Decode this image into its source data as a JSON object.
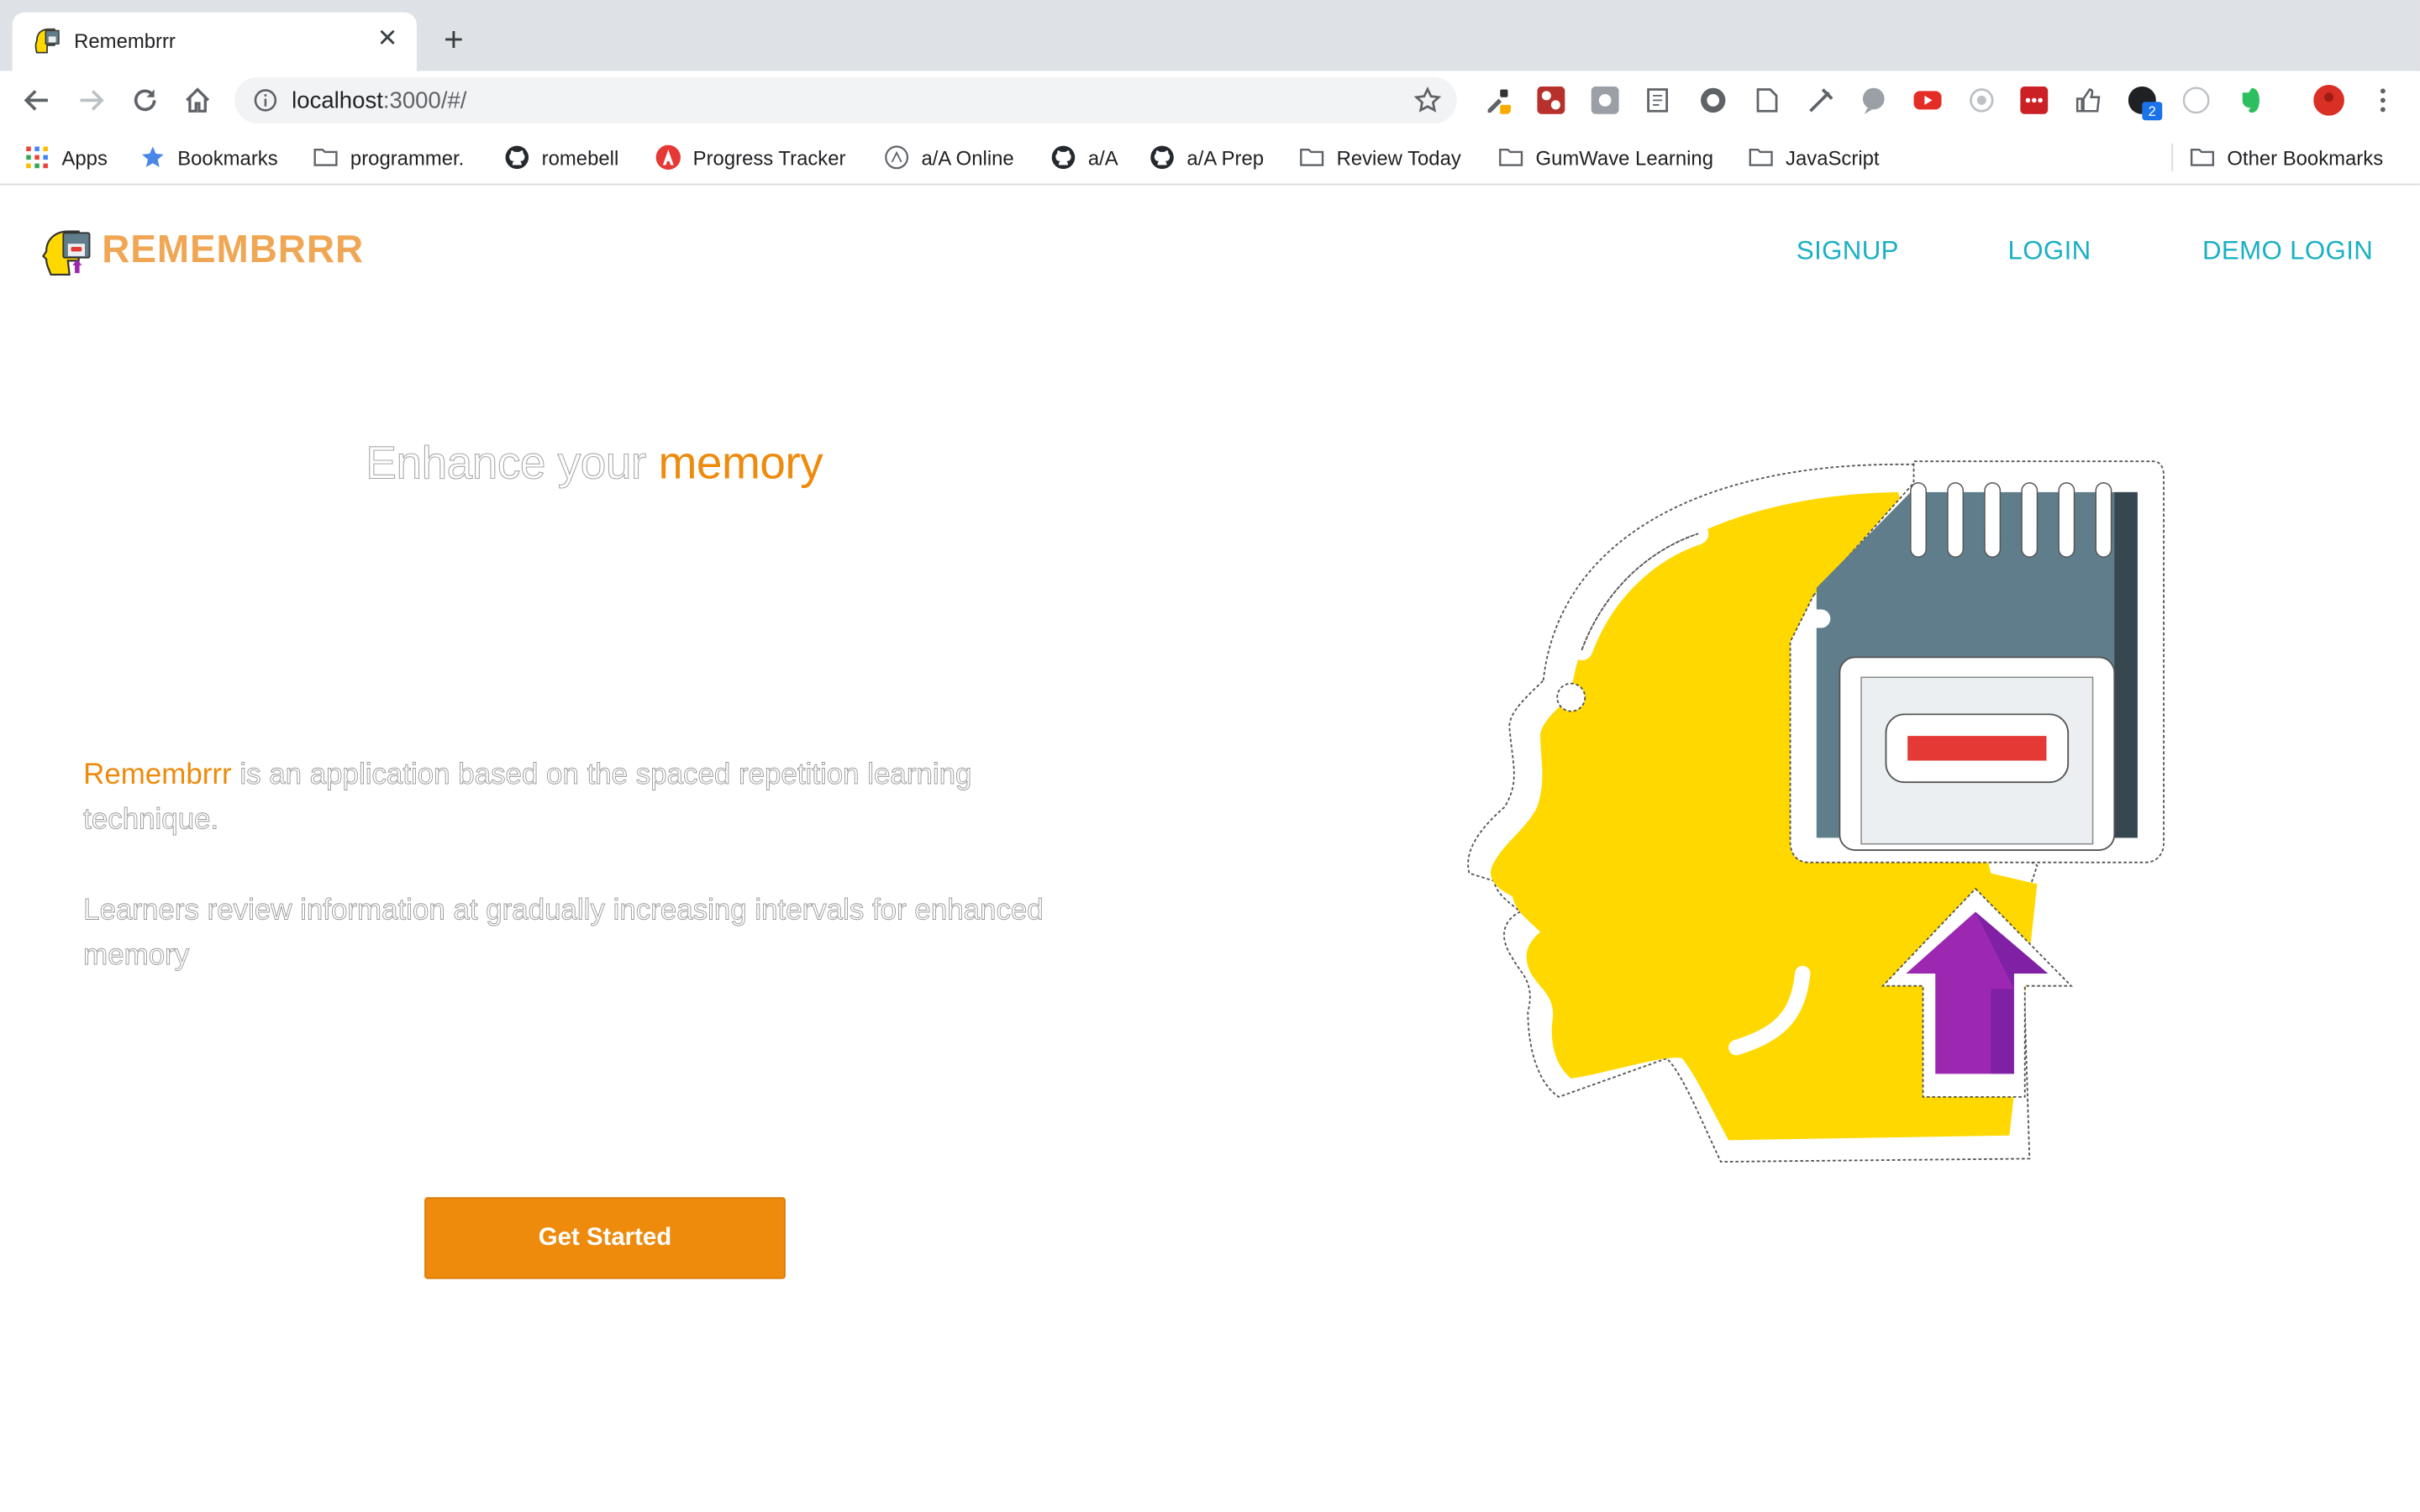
{
  "browser": {
    "tab": {
      "title": "Remembrrr",
      "close_glyph": "✕"
    },
    "new_tab_glyph": "+",
    "omnibox": {
      "host": "localhost",
      "path": ":3000/#/"
    },
    "bookmarks": [
      {
        "label": "Apps",
        "icon": "apps-grid-icon"
      },
      {
        "label": "Bookmarks",
        "icon": "star-icon"
      },
      {
        "label": "programmer.",
        "icon": "folder-icon"
      },
      {
        "label": "romebell",
        "icon": "github-icon"
      },
      {
        "label": "Progress Tracker",
        "icon": "app-academy-icon"
      },
      {
        "label": "a/A Online",
        "icon": "a-a-icon"
      },
      {
        "label": "a/A",
        "icon": "github-icon"
      },
      {
        "label": "a/A Prep",
        "icon": "github-icon"
      },
      {
        "label": "Review Today",
        "icon": "folder-icon"
      },
      {
        "label": "GumWave Learning",
        "icon": "folder-icon"
      },
      {
        "label": "JavaScript",
        "icon": "folder-icon"
      }
    ],
    "other_bookmarks": "Other Bookmarks",
    "extension_badges": {
      "profile_count": "2"
    }
  },
  "app": {
    "logo_text": "REMEMBRRR",
    "nav": {
      "signup": "SIGNUP",
      "login": "LOGIN",
      "demo_login": "DEMO LOGIN"
    },
    "hero": {
      "title_prefix": "Enhance your",
      "title_accent": "memory",
      "para1_accent": "Remembrrr",
      "para1_rest": "is an application based on the spaced repetition learning technique.",
      "para2": "Learners review information at gradually increasing intervals for enhanced memory"
    },
    "cta_label": "Get Started"
  },
  "colors": {
    "brand_orange": "#ee8a0c",
    "logo_orange": "#f0a755",
    "nav_teal": "#1ab0c4",
    "head_yellow": "#ffd800",
    "chip_slate": "#607d8b",
    "arrow_purple": "#9c27b0"
  }
}
